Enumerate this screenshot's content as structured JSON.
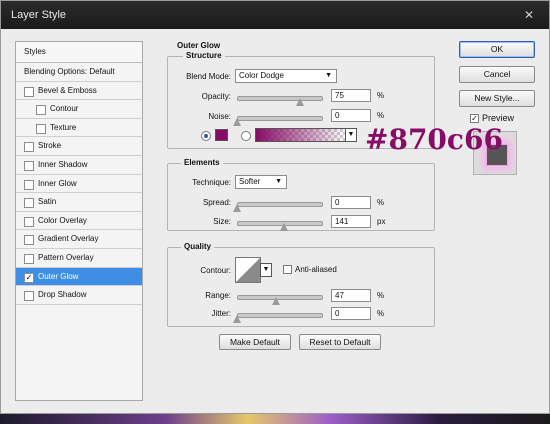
{
  "window": {
    "title": "Layer Style",
    "close_glyph": "✕"
  },
  "styles_list": {
    "header": "Styles",
    "items": [
      {
        "label": "Blending Options: Default",
        "checkbox": false,
        "checked": false,
        "indent": 0,
        "selected": false
      },
      {
        "label": "Bevel & Emboss",
        "checkbox": true,
        "checked": false,
        "indent": 0,
        "selected": false
      },
      {
        "label": "Contour",
        "checkbox": true,
        "checked": false,
        "indent": 1,
        "selected": false
      },
      {
        "label": "Texture",
        "checkbox": true,
        "checked": false,
        "indent": 1,
        "selected": false
      },
      {
        "label": "Stroke",
        "checkbox": true,
        "checked": false,
        "indent": 0,
        "selected": false
      },
      {
        "label": "Inner Shadow",
        "checkbox": true,
        "checked": false,
        "indent": 0,
        "selected": false
      },
      {
        "label": "Inner Glow",
        "checkbox": true,
        "checked": false,
        "indent": 0,
        "selected": false
      },
      {
        "label": "Satin",
        "checkbox": true,
        "checked": false,
        "indent": 0,
        "selected": false
      },
      {
        "label": "Color Overlay",
        "checkbox": true,
        "checked": false,
        "indent": 0,
        "selected": false
      },
      {
        "label": "Gradient Overlay",
        "checkbox": true,
        "checked": false,
        "indent": 0,
        "selected": false
      },
      {
        "label": "Pattern Overlay",
        "checkbox": true,
        "checked": false,
        "indent": 0,
        "selected": false
      },
      {
        "label": "Outer Glow",
        "checkbox": true,
        "checked": true,
        "indent": 0,
        "selected": true
      },
      {
        "label": "Drop Shadow",
        "checkbox": true,
        "checked": false,
        "indent": 0,
        "selected": false
      }
    ]
  },
  "buttons": {
    "ok": "OK",
    "cancel": "Cancel",
    "new_style": "New Style...",
    "preview_label": "Preview",
    "preview_checked": true,
    "make_default": "Make Default",
    "reset_default": "Reset to Default"
  },
  "outer_glow": {
    "title": "Outer Glow",
    "structure": {
      "title": "Structure",
      "blend_mode_label": "Blend Mode:",
      "blend_mode_value": "Color Dodge",
      "opacity_label": "Opacity:",
      "opacity_value": "75",
      "opacity_unit": "%",
      "opacity_level": 0.75,
      "noise_label": "Noise:",
      "noise_value": "0",
      "noise_unit": "%",
      "noise_level": 0,
      "color_swatch": "#870c66",
      "color_mode": "solid"
    },
    "elements": {
      "title": "Elements",
      "technique_label": "Technique:",
      "technique_value": "Softer",
      "spread_label": "Spread:",
      "spread_value": "0",
      "spread_unit": "%",
      "spread_level": 0,
      "size_label": "Size:",
      "size_value": "141",
      "size_unit": "px",
      "size_level": 0.56
    },
    "quality": {
      "title": "Quality",
      "contour_label": "Contour:",
      "anti_aliased_label": "Anti-aliased",
      "anti_aliased_checked": false,
      "range_label": "Range:",
      "range_value": "47",
      "range_unit": "%",
      "range_level": 0.47,
      "jitter_label": "Jitter:",
      "jitter_value": "0",
      "jitter_unit": "%",
      "jitter_level": 0
    }
  },
  "annotation": {
    "hex_text": "#870c66",
    "color": "#870c66"
  },
  "icons": {
    "dropdown": "chevron-down-icon",
    "checkmark": "✓"
  }
}
